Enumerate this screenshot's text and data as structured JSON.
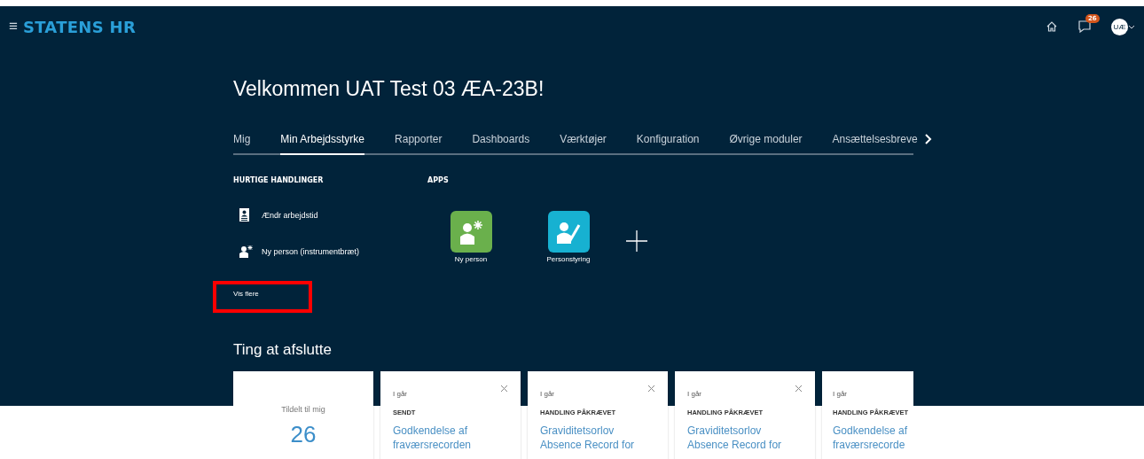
{
  "header": {
    "menu_icon": "≡",
    "brand": "STATENS HR",
    "notifications": "26",
    "avatar": "UÆ"
  },
  "welcome": "Velkommen UAT Test 03 ÆA-23B!",
  "tabs": [
    {
      "label": "Mig",
      "selected": false
    },
    {
      "label": "Min Arbejdsstyrke",
      "selected": true
    },
    {
      "label": "Rapporter",
      "selected": false
    },
    {
      "label": "Dashboards",
      "selected": false
    },
    {
      "label": "Værktøjer",
      "selected": false
    },
    {
      "label": "Konfiguration",
      "selected": false
    },
    {
      "label": "Øvrige moduler",
      "selected": false
    },
    {
      "label": "Ansættelsesbreve",
      "selected": false
    }
  ],
  "quick_actions": {
    "heading": "HURTIGE HANDLINGER",
    "items": [
      {
        "kind": "badge",
        "label": "Ændr arbejdstid"
      },
      {
        "kind": "person",
        "label": "Ny person (instrumentbræt)"
      }
    ],
    "more": "Vis flere",
    "highlighted": true
  },
  "apps": {
    "heading": "APPS",
    "items": [
      {
        "kind": "new",
        "label": "Ny person",
        "color": "#6ab04c"
      },
      {
        "kind": "edit",
        "label": "Personstyring",
        "color": "#17b1d1"
      }
    ]
  },
  "things": {
    "title": "Ting at afslutte",
    "summary": {
      "label": "Tildelt til mig",
      "count": "26"
    },
    "cards": [
      {
        "when": "I går",
        "status": "SENDT",
        "title": "Godkendelse af fraværsrecorden",
        "closable": true
      },
      {
        "when": "I går",
        "status": "HANDLING PÅKRÆVET",
        "title": "Graviditetsorlov Absence Record for",
        "closable": true
      },
      {
        "when": "I går",
        "status": "HANDLING PÅKRÆVET",
        "title": "Graviditetsorlov Absence Record for",
        "closable": true
      },
      {
        "when": "I går",
        "status": "HANDLING PÅKRÆVET",
        "title": "Godkendelse af fraværsrecorde",
        "closable": false
      }
    ]
  }
}
